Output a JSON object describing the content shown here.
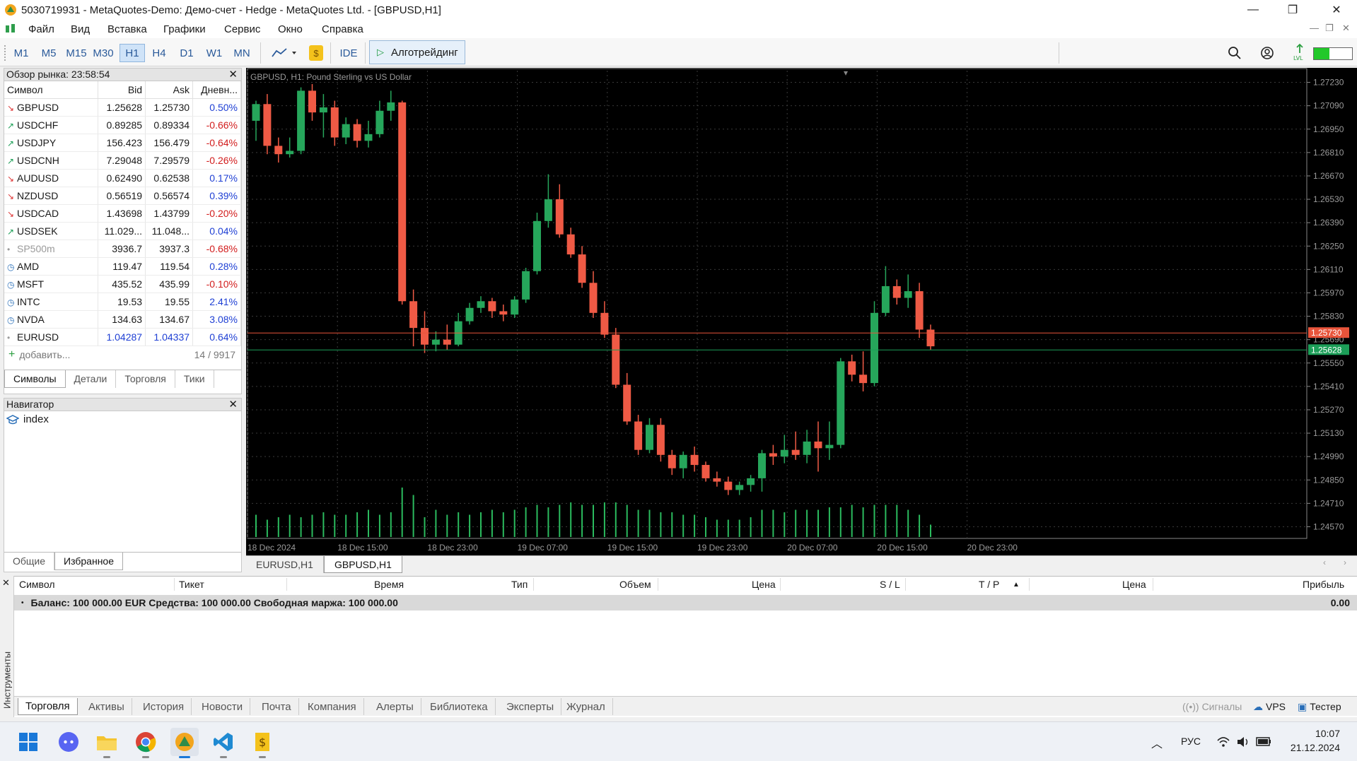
{
  "window": {
    "title": "5030719931 - MetaQuotes-Demo: Демо-счет - Hedge - MetaQuotes Ltd. - [GBPUSD,H1]",
    "minimize": "—",
    "maximize": "❐",
    "close": "✕"
  },
  "menu": [
    "Файл",
    "Вид",
    "Вставка",
    "Графики",
    "Сервис",
    "Окно",
    "Справка"
  ],
  "timeframes": [
    "M1",
    "M5",
    "M15",
    "M30",
    "H1",
    "H4",
    "D1",
    "W1",
    "MN"
  ],
  "active_timeframe": "H1",
  "toolbar": {
    "ide": "IDE",
    "algo": "Алготрейдинг"
  },
  "market_watch": {
    "title": "Обзор рынка: 23:58:54",
    "columns": [
      "Символ",
      "Bid",
      "Ask",
      "Дневн..."
    ],
    "rows": [
      {
        "sym": "GBPUSD",
        "bid": "1.25628",
        "ask": "1.25730",
        "chg": "0.50%",
        "dir": "down",
        "chg_sign": "pos"
      },
      {
        "sym": "USDCHF",
        "bid": "0.89285",
        "ask": "0.89334",
        "chg": "-0.66%",
        "dir": "up",
        "chg_sign": "neg"
      },
      {
        "sym": "USDJPY",
        "bid": "156.423",
        "ask": "156.479",
        "chg": "-0.64%",
        "dir": "up",
        "chg_sign": "neg"
      },
      {
        "sym": "USDCNH",
        "bid": "7.29048",
        "ask": "7.29579",
        "chg": "-0.26%",
        "dir": "up",
        "chg_sign": "neg"
      },
      {
        "sym": "AUDUSD",
        "bid": "0.62490",
        "ask": "0.62538",
        "chg": "0.17%",
        "dir": "down",
        "chg_sign": "pos"
      },
      {
        "sym": "NZDUSD",
        "bid": "0.56519",
        "ask": "0.56574",
        "chg": "0.39%",
        "dir": "down",
        "chg_sign": "pos"
      },
      {
        "sym": "USDCAD",
        "bid": "1.43698",
        "ask": "1.43799",
        "chg": "-0.20%",
        "dir": "down",
        "chg_sign": "neg"
      },
      {
        "sym": "USDSEK",
        "bid": "11.029...",
        "ask": "11.048...",
        "chg": "0.04%",
        "dir": "up",
        "chg_sign": "pos"
      },
      {
        "sym": "SP500m",
        "bid": "3936.7",
        "ask": "3937.3",
        "chg": "-0.68%",
        "dir": "dot",
        "chg_sign": "neg"
      },
      {
        "sym": "AMD",
        "bid": "119.47",
        "ask": "119.54",
        "chg": "0.28%",
        "dir": "clock",
        "chg_sign": "pos"
      },
      {
        "sym": "MSFT",
        "bid": "435.52",
        "ask": "435.99",
        "chg": "-0.10%",
        "dir": "clock",
        "chg_sign": "neg"
      },
      {
        "sym": "INTC",
        "bid": "19.53",
        "ask": "19.55",
        "chg": "2.41%",
        "dir": "clock",
        "chg_sign": "pos"
      },
      {
        "sym": "NVDA",
        "bid": "134.63",
        "ask": "134.67",
        "chg": "3.08%",
        "dir": "clock",
        "chg_sign": "pos"
      },
      {
        "sym": "EURUSD",
        "bid": "1.04287",
        "ask": "1.04337",
        "chg": "0.64%",
        "dir": "dot",
        "chg_sign": "pos"
      }
    ],
    "add_label": "добавить...",
    "count": "14 / 9917",
    "tabs": [
      "Символы",
      "Детали",
      "Торговля",
      "Тики"
    ]
  },
  "navigator": {
    "title": "Навигатор",
    "item": "index",
    "tabs": [
      "Общие",
      "Избранное"
    ]
  },
  "chart": {
    "label": "GBPUSD, H1:  Pound Sterling vs US Dollar",
    "ask_label": "1.25730",
    "bid_label": "1.25628",
    "price_ticks": [
      "1.27230",
      "1.27090",
      "1.26950",
      "1.26810",
      "1.26670",
      "1.26530",
      "1.26390",
      "1.26250",
      "1.26110",
      "1.25970",
      "1.25830",
      "1.25690",
      "1.25550",
      "1.25410",
      "1.25270",
      "1.25130",
      "1.24990",
      "1.24850",
      "1.24710",
      "1.24570"
    ],
    "time_ticks": [
      "18 Dec 2024",
      "18 Dec 15:00",
      "18 Dec 23:00",
      "19 Dec 07:00",
      "19 Dec 15:00",
      "19 Dec 23:00",
      "20 Dec 07:00",
      "20 Dec 15:00",
      "20 Dec 23:00"
    ],
    "tabs": [
      "EURUSD,H1",
      "GBPUSD,H1"
    ]
  },
  "chart_data": {
    "type": "candlestick",
    "title": "GBPUSD, H1:  Pound Sterling vs US Dollar",
    "ylim": [
      1.245,
      1.273
    ],
    "ask": 1.2573,
    "bid": 1.25628,
    "candles": [
      {
        "o": 1.27,
        "h": 1.2712,
        "l": 1.2688,
        "c": 1.271
      },
      {
        "o": 1.271,
        "h": 1.2716,
        "l": 1.268,
        "c": 1.2685
      },
      {
        "o": 1.2685,
        "h": 1.269,
        "l": 1.2675,
        "c": 1.268
      },
      {
        "o": 1.268,
        "h": 1.269,
        "l": 1.2678,
        "c": 1.2682
      },
      {
        "o": 1.2682,
        "h": 1.272,
        "l": 1.268,
        "c": 1.2718
      },
      {
        "o": 1.2718,
        "h": 1.2722,
        "l": 1.27,
        "c": 1.2705
      },
      {
        "o": 1.2705,
        "h": 1.2716,
        "l": 1.269,
        "c": 1.2708
      },
      {
        "o": 1.2708,
        "h": 1.2712,
        "l": 1.2685,
        "c": 1.269
      },
      {
        "o": 1.269,
        "h": 1.2702,
        "l": 1.2686,
        "c": 1.2698
      },
      {
        "o": 1.2698,
        "h": 1.2701,
        "l": 1.2684,
        "c": 1.2688
      },
      {
        "o": 1.2688,
        "h": 1.27,
        "l": 1.2684,
        "c": 1.2692
      },
      {
        "o": 1.2692,
        "h": 1.2712,
        "l": 1.269,
        "c": 1.2706
      },
      {
        "o": 1.2706,
        "h": 1.2718,
        "l": 1.27,
        "c": 1.2711
      },
      {
        "o": 1.2711,
        "h": 1.2712,
        "l": 1.259,
        "c": 1.2592
      },
      {
        "o": 1.2592,
        "h": 1.2599,
        "l": 1.2565,
        "c": 1.2576
      },
      {
        "o": 1.2576,
        "h": 1.2586,
        "l": 1.2561,
        "c": 1.2566
      },
      {
        "o": 1.2566,
        "h": 1.2574,
        "l": 1.2562,
        "c": 1.2569
      },
      {
        "o": 1.2569,
        "h": 1.2578,
        "l": 1.2563,
        "c": 1.2566
      },
      {
        "o": 1.2566,
        "h": 1.2585,
        "l": 1.2565,
        "c": 1.258
      },
      {
        "o": 1.258,
        "h": 1.2591,
        "l": 1.2578,
        "c": 1.2588
      },
      {
        "o": 1.2588,
        "h": 1.2595,
        "l": 1.2585,
        "c": 1.2592
      },
      {
        "o": 1.2592,
        "h": 1.2594,
        "l": 1.2582,
        "c": 1.2586
      },
      {
        "o": 1.2586,
        "h": 1.259,
        "l": 1.258,
        "c": 1.2584
      },
      {
        "o": 1.2584,
        "h": 1.2595,
        "l": 1.2582,
        "c": 1.2593
      },
      {
        "o": 1.2593,
        "h": 1.2612,
        "l": 1.2591,
        "c": 1.261
      },
      {
        "o": 1.261,
        "h": 1.2645,
        "l": 1.2608,
        "c": 1.264
      },
      {
        "o": 1.264,
        "h": 1.2668,
        "l": 1.2636,
        "c": 1.2653
      },
      {
        "o": 1.2653,
        "h": 1.2662,
        "l": 1.263,
        "c": 1.2632
      },
      {
        "o": 1.2632,
        "h": 1.2636,
        "l": 1.2618,
        "c": 1.262
      },
      {
        "o": 1.262,
        "h": 1.2625,
        "l": 1.26,
        "c": 1.2603
      },
      {
        "o": 1.2603,
        "h": 1.261,
        "l": 1.2582,
        "c": 1.2585
      },
      {
        "o": 1.2585,
        "h": 1.2592,
        "l": 1.257,
        "c": 1.2572
      },
      {
        "o": 1.2572,
        "h": 1.2576,
        "l": 1.254,
        "c": 1.2542
      },
      {
        "o": 1.2542,
        "h": 1.2549,
        "l": 1.2518,
        "c": 1.252
      },
      {
        "o": 1.252,
        "h": 1.2524,
        "l": 1.25,
        "c": 1.2503
      },
      {
        "o": 1.2503,
        "h": 1.2522,
        "l": 1.2501,
        "c": 1.2518
      },
      {
        "o": 1.2518,
        "h": 1.2522,
        "l": 1.2496,
        "c": 1.25
      },
      {
        "o": 1.25,
        "h": 1.2503,
        "l": 1.2488,
        "c": 1.2492
      },
      {
        "o": 1.2492,
        "h": 1.2502,
        "l": 1.2486,
        "c": 1.25
      },
      {
        "o": 1.25,
        "h": 1.2505,
        "l": 1.249,
        "c": 1.2494
      },
      {
        "o": 1.2494,
        "h": 1.2496,
        "l": 1.2484,
        "c": 1.2486
      },
      {
        "o": 1.2486,
        "h": 1.249,
        "l": 1.2481,
        "c": 1.2484
      },
      {
        "o": 1.2484,
        "h": 1.2487,
        "l": 1.2476,
        "c": 1.2479
      },
      {
        "o": 1.2479,
        "h": 1.2484,
        "l": 1.2476,
        "c": 1.2482
      },
      {
        "o": 1.2482,
        "h": 1.2488,
        "l": 1.2478,
        "c": 1.2486
      },
      {
        "o": 1.2486,
        "h": 1.2503,
        "l": 1.2478,
        "c": 1.2501
      },
      {
        "o": 1.2501,
        "h": 1.2506,
        "l": 1.2494,
        "c": 1.2499
      },
      {
        "o": 1.2499,
        "h": 1.2512,
        "l": 1.2495,
        "c": 1.2503
      },
      {
        "o": 1.2503,
        "h": 1.2514,
        "l": 1.2497,
        "c": 1.25
      },
      {
        "o": 1.25,
        "h": 1.2515,
        "l": 1.2495,
        "c": 1.2508
      },
      {
        "o": 1.2508,
        "h": 1.252,
        "l": 1.249,
        "c": 1.2504
      },
      {
        "o": 1.2504,
        "h": 1.252,
        "l": 1.2497,
        "c": 1.2506
      },
      {
        "o": 1.2506,
        "h": 1.2558,
        "l": 1.2504,
        "c": 1.2556
      },
      {
        "o": 1.2556,
        "h": 1.256,
        "l": 1.2544,
        "c": 1.2548
      },
      {
        "o": 1.2548,
        "h": 1.2562,
        "l": 1.2538,
        "c": 1.2543
      },
      {
        "o": 1.2543,
        "h": 1.2592,
        "l": 1.2541,
        "c": 1.2585
      },
      {
        "o": 1.2585,
        "h": 1.2613,
        "l": 1.2583,
        "c": 1.2601
      },
      {
        "o": 1.2601,
        "h": 1.2605,
        "l": 1.259,
        "c": 1.2594
      },
      {
        "o": 1.2594,
        "h": 1.2608,
        "l": 1.2588,
        "c": 1.2598
      },
      {
        "o": 1.2598,
        "h": 1.2603,
        "l": 1.257,
        "c": 1.2575
      },
      {
        "o": 1.2575,
        "h": 1.2578,
        "l": 1.2563,
        "c": 1.2565
      }
    ],
    "volumes": [
      0.45,
      0.35,
      0.4,
      0.45,
      0.4,
      0.45,
      0.5,
      0.45,
      0.45,
      0.5,
      0.55,
      0.45,
      0.5,
      1.0,
      0.85,
      0.4,
      0.55,
      0.45,
      0.5,
      0.45,
      0.5,
      0.55,
      0.5,
      0.55,
      0.6,
      0.65,
      0.6,
      0.65,
      0.7,
      0.65,
      0.65,
      0.7,
      0.7,
      0.65,
      0.55,
      0.55,
      0.5,
      0.5,
      0.45,
      0.45,
      0.4,
      0.35,
      0.35,
      0.35,
      0.4,
      0.55,
      0.55,
      0.5,
      0.55,
      0.55,
      0.55,
      0.6,
      0.6,
      0.65,
      0.6,
      0.65,
      0.65,
      0.65,
      0.55,
      0.45,
      0.25
    ]
  },
  "toolbox": {
    "columns": [
      "Символ",
      "Тикет",
      "Время",
      "Тип",
      "Объем",
      "Цена",
      "S / L",
      "T / P",
      "Цена",
      "Прибыль"
    ],
    "balance": "Баланс: 100 000.00 EUR  Средства: 100 000.00  Свободная маржа: 100 000.00",
    "profit": "0.00",
    "side_label": "Инструменты",
    "tabs": [
      "Торговля",
      "Активы",
      "История",
      "Новости",
      "Почта",
      "Компания",
      "Алерты",
      "Библиотека",
      "Эксперты",
      "Журнал"
    ],
    "right": {
      "signals": "Сигналы",
      "vps": "VPS",
      "tester": "Тестер"
    }
  },
  "taskbar": {
    "lang": "РУС",
    "time": "10:07",
    "date": "21.12.2024"
  },
  "colors": {
    "bull": "#26a65b",
    "bear": "#ef5a45",
    "ask_line": "#e8543b",
    "bid_line": "#1c9e58",
    "volume": "#2bbb5e"
  }
}
